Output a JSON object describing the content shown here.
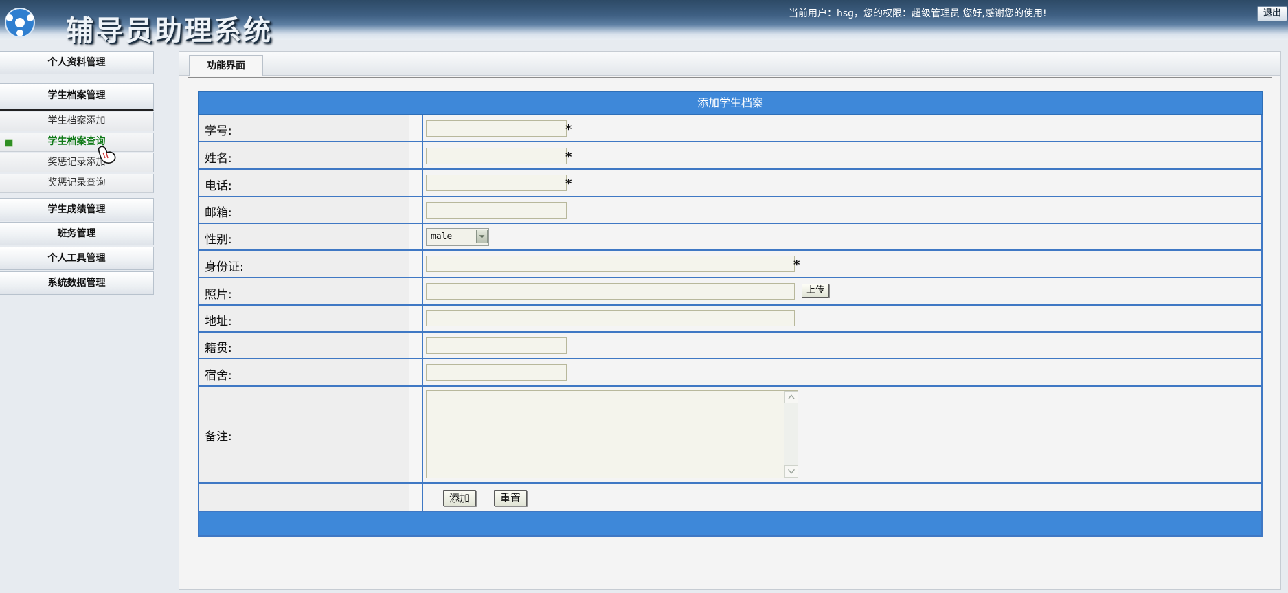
{
  "header": {
    "title": "辅导员助理系统",
    "user_info": "当前用户：hsg，您的权限：超级管理员 您好,感谢您的使用!",
    "logout_label": "退出"
  },
  "sidebar": {
    "personal_info": "个人资料管理",
    "student_archive": "学生档案管理",
    "sub_items": [
      "学生档案添加",
      "学生档案查询",
      "奖惩记录添加",
      "奖惩记录查询"
    ],
    "grade_mgmt": "学生成绩管理",
    "class_mgmt": "班务管理",
    "tools_mgmt": "个人工具管理",
    "system_data": "系统数据管理"
  },
  "tabs": [
    "功能界面"
  ],
  "form": {
    "title": "添加学生档案",
    "fields": {
      "student_id": "学号:",
      "name": "姓名:",
      "phone": "电话:",
      "email": "邮箱:",
      "gender": "性别:",
      "id_card": "身份证:",
      "photo": "照片:",
      "address": "地址:",
      "native_place": "籍贯:",
      "dorm": "宿舍:",
      "remarks": "备注:"
    },
    "required_mark": "*",
    "gender_value": "male",
    "upload_label": "上传",
    "add_label": "添加",
    "reset_label": "重置"
  },
  "colors": {
    "header_bar": "#3e88d9",
    "border": "#3f78c4",
    "active_menu": "#0f7a17"
  }
}
